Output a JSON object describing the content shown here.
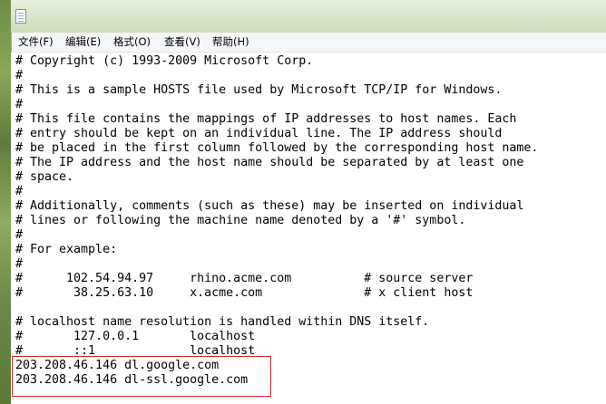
{
  "window": {
    "title": "",
    "icon": "notepad-icon"
  },
  "menubar": {
    "file": "文件(F)",
    "edit": "编辑(E)",
    "format": "格式(O)",
    "view": "查看(V)",
    "help": "帮助(H)"
  },
  "editor": {
    "lines": [
      "# Copyright (c) 1993-2009 Microsoft Corp.",
      "#",
      "# This is a sample HOSTS file used by Microsoft TCP/IP for Windows.",
      "#",
      "# This file contains the mappings of IP addresses to host names. Each",
      "# entry should be kept on an individual line. The IP address should",
      "# be placed in the first column followed by the corresponding host name.",
      "# The IP address and the host name should be separated by at least one",
      "# space.",
      "#",
      "# Additionally, comments (such as these) may be inserted on individual",
      "# lines or following the machine name denoted by a '#' symbol.",
      "#",
      "# For example:",
      "#",
      "#      102.54.94.97     rhino.acme.com          # source server",
      "#       38.25.63.10     x.acme.com              # x client host",
      "",
      "# localhost name resolution is handled within DNS itself.",
      "#\t127.0.0.1       localhost",
      "#\t::1             localhost",
      "203.208.46.146 dl.google.com",
      "203.208.46.146 dl-ssl.google.com"
    ]
  },
  "annotation": {
    "highlight_color": "#d32828"
  }
}
